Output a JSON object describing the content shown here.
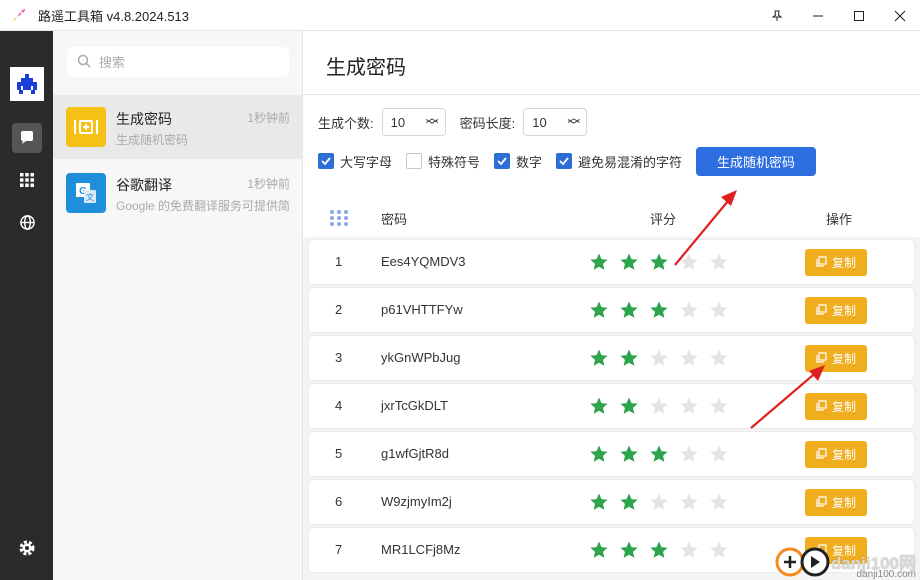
{
  "titlebar": {
    "title": "路遥工具箱 v4.8.2024.513"
  },
  "search": {
    "placeholder": "搜索"
  },
  "tools": [
    {
      "name": "生成密码",
      "desc": "生成随机密码",
      "time": "1秒钟前",
      "icon": "password-tool-icon",
      "color": "#f5c116"
    },
    {
      "name": "谷歌翻译",
      "desc": "Google 的免费翻译服务可提供简",
      "time": "1秒钟前",
      "icon": "translate-tool-icon",
      "color": "#1e8fd8"
    }
  ],
  "main": {
    "title": "生成密码",
    "count_label": "生成个数:",
    "count_value": "10",
    "length_label": "密码长度:",
    "length_value": "10",
    "options": [
      {
        "label": "大写字母",
        "checked": true
      },
      {
        "label": "特殊符号",
        "checked": false
      },
      {
        "label": "数字",
        "checked": true
      },
      {
        "label": "避免易混淆的字符",
        "checked": true
      }
    ],
    "generate_label": "生成随机密码"
  },
  "table": {
    "headers": {
      "password": "密码",
      "score": "评分",
      "action": "操作"
    },
    "copy_label": "复制",
    "rows": [
      {
        "idx": "1",
        "password": "Ees4YQMDV3",
        "score": 3
      },
      {
        "idx": "2",
        "password": "p61VHTTFYw",
        "score": 3
      },
      {
        "idx": "3",
        "password": "ykGnWPbJug",
        "score": 2
      },
      {
        "idx": "4",
        "password": "jxrTcGkDLT",
        "score": 2
      },
      {
        "idx": "5",
        "password": "g1wfGjtR8d",
        "score": 3
      },
      {
        "idx": "6",
        "password": "W9zjmyIm2j",
        "score": 2
      },
      {
        "idx": "7",
        "password": "MR1LCFj8Mz",
        "score": 3
      }
    ]
  },
  "colors": {
    "star_on": "#2ea44f",
    "star_off": "#e4e4e4",
    "copy_button": "#f0ad1e",
    "primary": "#2d6fe0",
    "arrow": "#e02020"
  },
  "watermark": {
    "text": "danji100网",
    "url": "danji100.com"
  }
}
